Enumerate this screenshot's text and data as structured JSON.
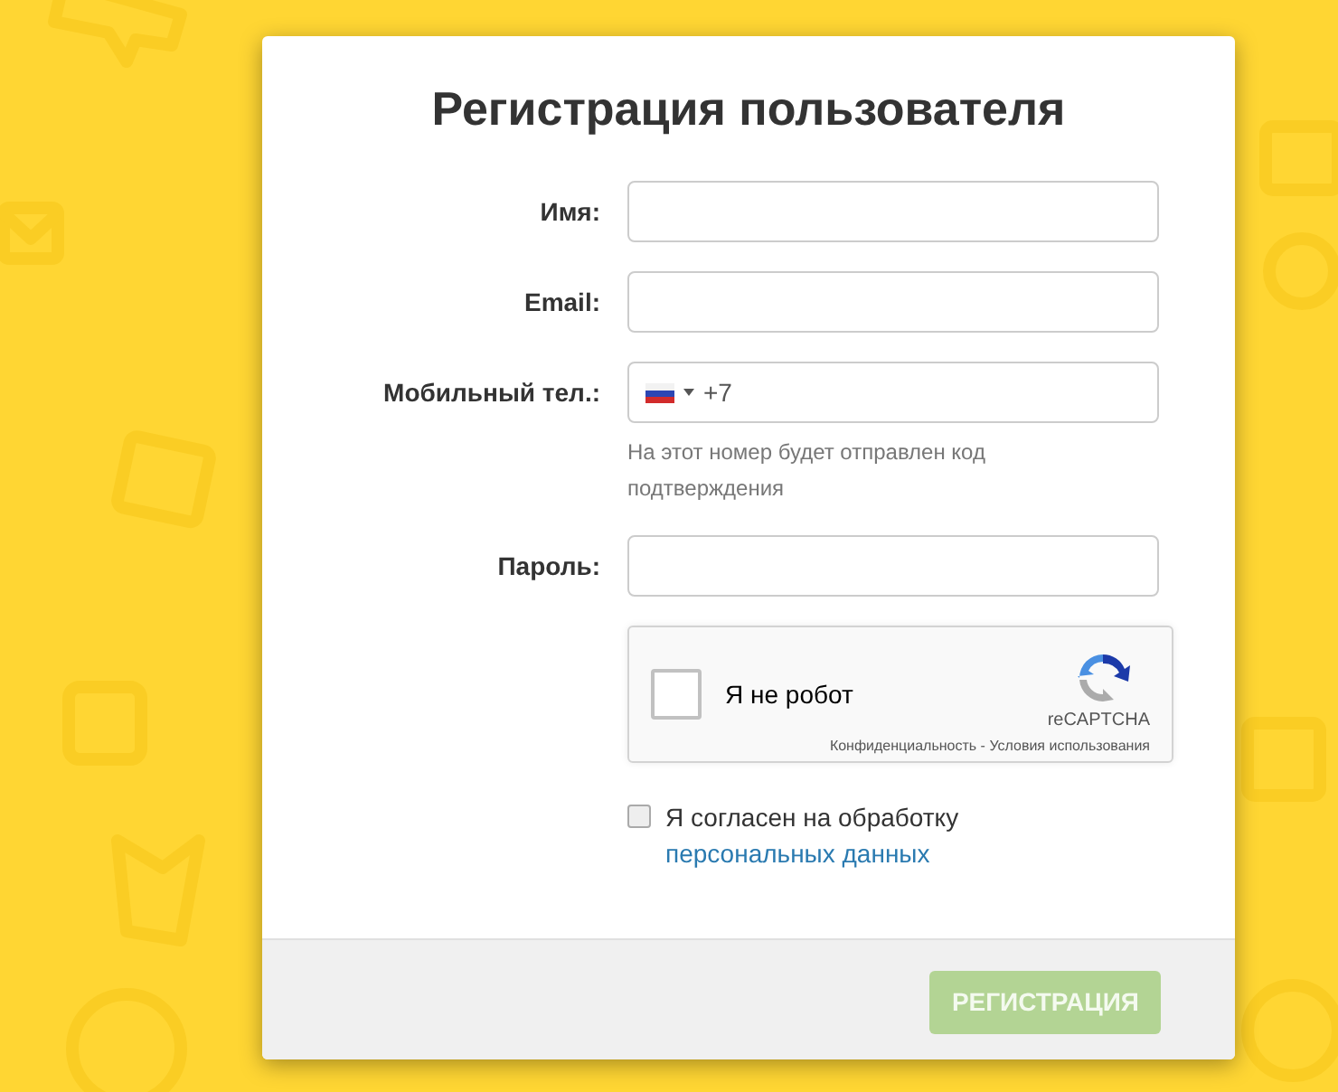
{
  "title": "Регистрация пользователя",
  "fields": [
    {
      "kind": "text",
      "label": "Имя:"
    },
    {
      "kind": "text",
      "label": "Email:"
    },
    {
      "kind": "phone",
      "label": "Мобильный тел.:",
      "value": "+7",
      "hint": "На этот номер будет отправлен код подтверждения"
    },
    {
      "kind": "password",
      "label": "Пароль:"
    }
  ],
  "captcha": {
    "label": "Я не робот",
    "checked": false,
    "brand": "reCAPTCHA",
    "links": "Конфиденциальность - Условия использования"
  },
  "consent": {
    "checked": false,
    "text": "Я согласен на обработку",
    "link": "персональных данных"
  },
  "submit": {
    "label": "РЕГИСТРАЦИЯ",
    "disabled": true
  }
}
